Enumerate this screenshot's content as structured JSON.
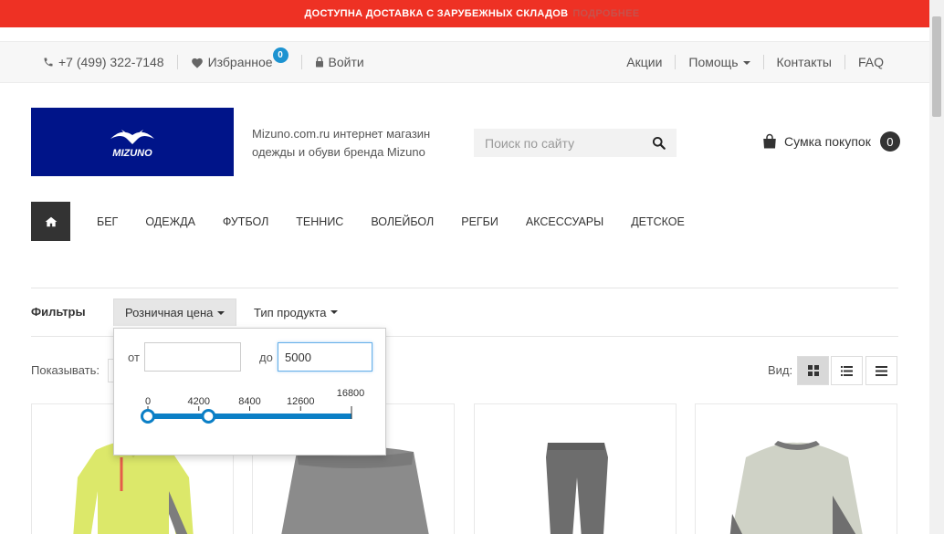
{
  "promo": {
    "text": "ДОСТУПНА ДОСТАВКА С ЗАРУБЕЖНЫХ СКЛАДОВ",
    "link": "ПОДРОБНЕЕ"
  },
  "topbar": {
    "phone": "+7 (499) 322-7148",
    "favorites_label": "Избранное",
    "favorites_count": "0",
    "login_label": "Войти",
    "links": [
      "Акции",
      "Помощь",
      "Контакты",
      "FAQ"
    ]
  },
  "header": {
    "logo_text": "MIZUNO",
    "tagline": "Mizuno.com.ru интернет магазин одежды и обуви бренда Mizuno",
    "search_placeholder": "Поиск по сайту",
    "cart_label": "Сумка покупок",
    "cart_count": "0"
  },
  "nav": {
    "items": [
      "БЕГ",
      "ОДЕЖДА",
      "ФУТБОЛ",
      "ТЕННИС",
      "ВОЛЕЙБОЛ",
      "РЕГБИ",
      "АКСЕССУАРЫ",
      "ДЕТСКОЕ"
    ]
  },
  "filters": {
    "label": "Фильтры",
    "price_label": "Розничная цена",
    "type_label": "Тип продукта",
    "price_popup": {
      "from_label": "от",
      "from_value": "",
      "to_label": "до",
      "to_value": "5000",
      "ticks": [
        "0",
        "4200",
        "8400",
        "12600",
        "16800"
      ],
      "range_min": 0,
      "range_max": 16800,
      "handle_low": 0,
      "handle_high": 5000
    }
  },
  "listing": {
    "show_label": "Показывать:",
    "view_label": "Вид:"
  },
  "colors": {
    "promo": "#ee3124",
    "brand": "#001489",
    "accent": "#1c93d1",
    "slider": "#0b7fc6"
  }
}
